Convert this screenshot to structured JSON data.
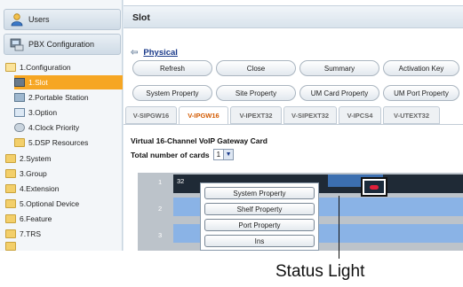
{
  "sidebar": {
    "users_label": "Users",
    "pbx_label": "PBX Configuration",
    "items": [
      {
        "label": "1.Configuration"
      },
      {
        "label": "1.Slot"
      },
      {
        "label": "2.Portable Station"
      },
      {
        "label": "3.Option"
      },
      {
        "label": "4.Clock Priority"
      },
      {
        "label": "5.DSP Resources"
      },
      {
        "label": "2.System"
      },
      {
        "label": "3.Group"
      },
      {
        "label": "4.Extension"
      },
      {
        "label": "5.Optional Device"
      },
      {
        "label": "6.Feature"
      },
      {
        "label": "7.TRS"
      }
    ]
  },
  "main": {
    "title": "Slot",
    "breadcrumb": "Physical",
    "buttons_row1": [
      "Refresh",
      "Close",
      "Summary",
      "Activation Key"
    ],
    "buttons_row2": [
      "System Property",
      "Site Property",
      "UM Card Property",
      "UM Port Property"
    ],
    "tabs": [
      "V-SIPGW16",
      "V-IPGW16",
      "V-IPEXT32",
      "V-SIPEXT32",
      "V-IPCS4",
      "V-UTEXT32"
    ],
    "active_tab": "V-IPGW16",
    "card_title": "Virtual 16-Channel VoIP Gateway Card",
    "cards_label": "Total number of cards",
    "cards_value": "1",
    "rows": [
      "1",
      "2",
      "3"
    ],
    "slot_text": "32",
    "context_menu": [
      "System Property",
      "Shelf Property",
      "Port Property",
      "Ins"
    ]
  },
  "annotation": {
    "label": "Status Light"
  },
  "colors": {
    "selected": "#f6a623",
    "active_tab": "#d35a00",
    "status_light": "#e0203a",
    "row_blue": "#8ab3e6"
  }
}
